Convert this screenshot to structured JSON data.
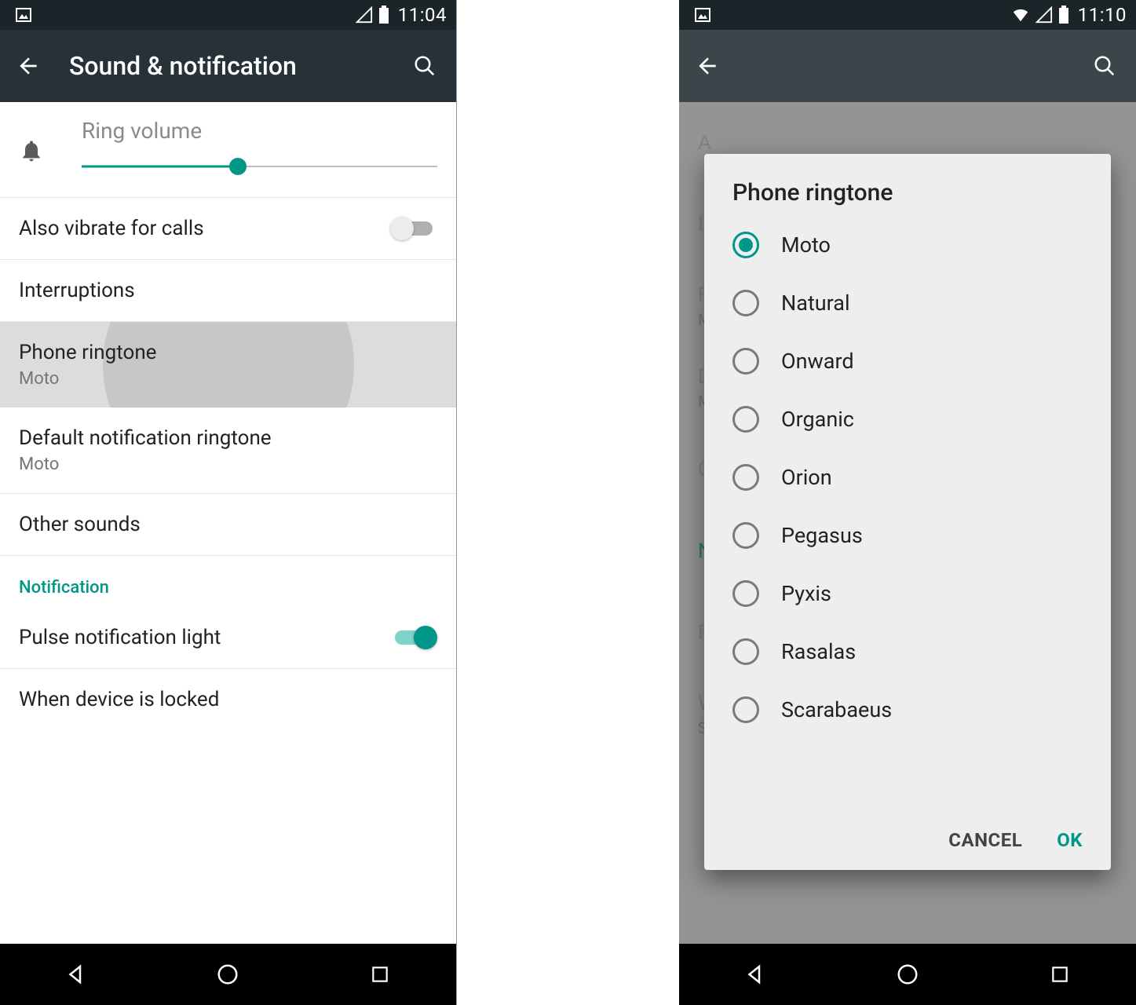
{
  "left": {
    "status": {
      "time": "11:04"
    },
    "appbar": {
      "title": "Sound & notification"
    },
    "ring": {
      "label": "Ring volume",
      "value_pct": 44
    },
    "items": {
      "vibrate": {
        "title": "Also vibrate for calls",
        "on": false
      },
      "interruptions": {
        "title": "Interruptions"
      },
      "ringtone": {
        "title": "Phone ringtone",
        "sub": "Moto"
      },
      "default_notif": {
        "title": "Default notification ringtone",
        "sub": "Moto"
      },
      "other_sounds": {
        "title": "Other sounds"
      },
      "section_notification": "Notification",
      "pulse": {
        "title": "Pulse notification light",
        "on": true
      },
      "locked": {
        "title": "When device is locked"
      }
    }
  },
  "right": {
    "status": {
      "time": "11:10"
    },
    "dialog": {
      "title": "Phone ringtone",
      "options": [
        "Moto",
        "Natural",
        "Onward",
        "Organic",
        "Orion",
        "Pegasus",
        "Pyxis",
        "Rasalas",
        "Scarabaeus"
      ],
      "selected": "Moto",
      "cancel": "CANCEL",
      "ok": "OK"
    }
  },
  "colors": {
    "accent": "#009688",
    "appbar": "#263238",
    "status": "#1b2428"
  }
}
